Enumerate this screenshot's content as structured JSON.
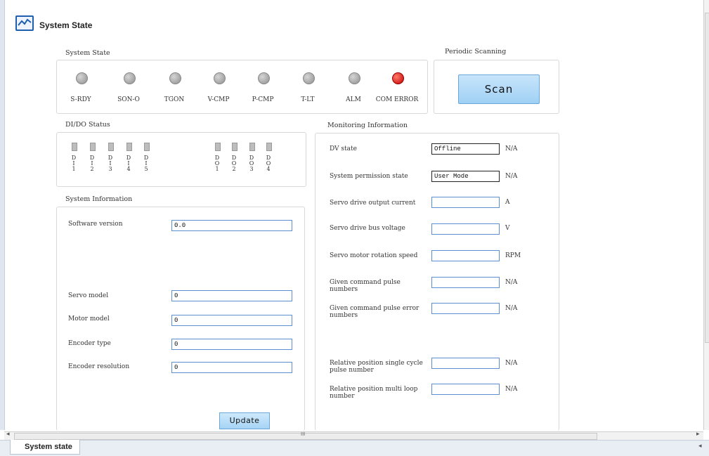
{
  "header": {
    "title": "System State",
    "icon": "monitor-chart-icon"
  },
  "system_state": {
    "title": "System State",
    "indicators": [
      {
        "label": "S-RDY",
        "status": "off"
      },
      {
        "label": "SON-O",
        "status": "off"
      },
      {
        "label": "TGON",
        "status": "off"
      },
      {
        "label": "V-CMP",
        "status": "off"
      },
      {
        "label": "P-CMP",
        "status": "off"
      },
      {
        "label": "T-LT",
        "status": "off"
      },
      {
        "label": "ALM",
        "status": "off"
      },
      {
        "label": "COM ERROR",
        "status": "on",
        "color": "#d00000"
      }
    ]
  },
  "periodic": {
    "title": "Periodic Scanning",
    "scan_label": "Scan"
  },
  "dido": {
    "title": "DI/DO Status",
    "di": [
      {
        "l1": "D",
        "l2": "I",
        "l3": "1"
      },
      {
        "l1": "D",
        "l2": "I",
        "l3": "2"
      },
      {
        "l1": "D",
        "l2": "I",
        "l3": "3"
      },
      {
        "l1": "D",
        "l2": "I",
        "l3": "4"
      },
      {
        "l1": "D",
        "l2": "I",
        "l3": "5"
      }
    ],
    "do": [
      {
        "l1": "D",
        "l2": "O",
        "l3": "1"
      },
      {
        "l1": "D",
        "l2": "O",
        "l3": "2"
      },
      {
        "l1": "D",
        "l2": "O",
        "l3": "3"
      },
      {
        "l1": "D",
        "l2": "O",
        "l3": "4"
      }
    ]
  },
  "sysinfo": {
    "title": "System Information",
    "fields": [
      {
        "label": "Software version",
        "value": "0.0"
      },
      {
        "label": "Servo model",
        "value": "0"
      },
      {
        "label": "Motor model",
        "value": "0"
      },
      {
        "label": "Encoder type",
        "value": "0"
      },
      {
        "label": "Encoder resolution",
        "value": "0"
      }
    ],
    "update_label": "Update"
  },
  "monitor": {
    "title": "Monitoring Information",
    "fields": [
      {
        "label": "DV state",
        "value": "Offline",
        "unit": "N/A"
      },
      {
        "label": "System permission state",
        "value": "User Mode",
        "unit": "N/A"
      },
      {
        "label": "Servo drive output current",
        "value": "",
        "unit": "A"
      },
      {
        "label": "Servo drive bus voltage",
        "value": "",
        "unit": "V"
      },
      {
        "label": "Servo motor rotation speed",
        "value": "",
        "unit": "RPM"
      },
      {
        "label": "Given command pulse numbers",
        "value": "",
        "unit": "N/A"
      },
      {
        "label": "Given command pulse error numbers",
        "value": "",
        "unit": "N/A"
      },
      {
        "label": "Relative position single cycle pulse number",
        "value": "",
        "unit": "N/A"
      },
      {
        "label": "Relative position multi loop number",
        "value": "",
        "unit": "N/A"
      }
    ]
  },
  "scrollbar": {
    "middle_glyph": "III"
  },
  "tabs": [
    {
      "label": "System state"
    }
  ]
}
